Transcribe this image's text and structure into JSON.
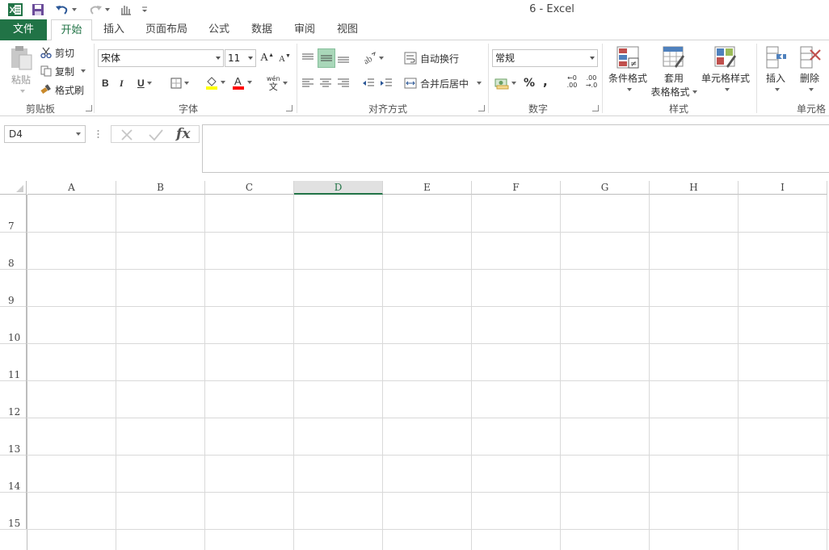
{
  "window": {
    "title": "6 - Excel"
  },
  "tabs": {
    "file": "文件",
    "home": "开始",
    "insert": "插入",
    "page_layout": "页面布局",
    "formulas": "公式",
    "data": "数据",
    "review": "审阅",
    "view": "视图"
  },
  "ribbon": {
    "clipboard": {
      "paste": "粘贴",
      "cut": "剪切",
      "copy": "复制",
      "format_painter": "格式刷",
      "label": "剪贴板"
    },
    "font": {
      "name": "宋体",
      "size": "11",
      "bold": "B",
      "italic": "I",
      "underline": "U",
      "grow": "A",
      "shrink": "A",
      "phonetic_top": "wén",
      "phonetic_bottom": "文",
      "label": "字体"
    },
    "alignment": {
      "wrap_text": "自动换行",
      "merge_center": "合并后居中",
      "label": "对齐方式"
    },
    "number": {
      "format": "常规",
      "percent": "%",
      "comma": ",",
      "inc_decimal_top": "←0",
      "inc_decimal_bottom": ".00",
      "dec_decimal_top": ".00",
      "dec_decimal_bottom": "→.0",
      "label": "数字"
    },
    "styles": {
      "conditional": "条件格式",
      "format_table_1": "套用",
      "format_table_2": "表格格式",
      "cell_styles": "单元格样式",
      "label": "样式"
    },
    "cells": {
      "insert": "插入",
      "delete": "删除",
      "label": "单元格"
    }
  },
  "formula_bar": {
    "name_box": "D4",
    "fx": "fx",
    "content": ""
  },
  "grid": {
    "columns": [
      "A",
      "B",
      "C",
      "D",
      "E",
      "F",
      "G",
      "H",
      "I"
    ],
    "selected_column": "D",
    "rows": [
      "7",
      "8",
      "9",
      "10",
      "11",
      "12",
      "13",
      "14",
      "15"
    ]
  },
  "colors": {
    "accent": "#217346",
    "wrap_highlight": "#a9d7b9",
    "fill_yellow": "#ffff00",
    "font_red": "#ff0000"
  }
}
